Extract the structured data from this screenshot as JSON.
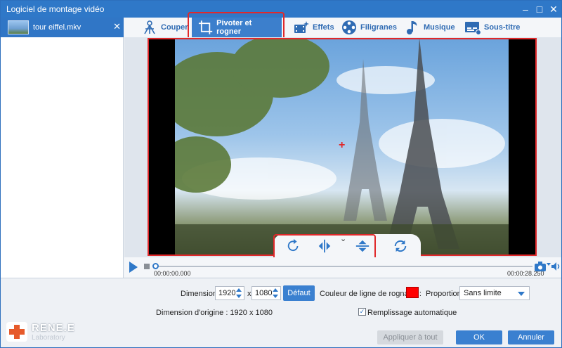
{
  "window": {
    "title": "Logiciel de montage vidéo",
    "min_icon": "–",
    "close_icon": "✕"
  },
  "sidebar": {
    "file_name": "tour eiffel.mkv",
    "close_icon": "✕"
  },
  "tabs": [
    {
      "label": "Couper",
      "icon": "tripod-icon"
    },
    {
      "label": "Pivoter et rogner",
      "icon": "crop-icon",
      "active": true
    },
    {
      "label": "Effets",
      "icon": "effects-film-icon"
    },
    {
      "label": "Filigranes",
      "icon": "watermark-reel-icon"
    },
    {
      "label": "Musique",
      "icon": "music-note-icon"
    },
    {
      "label": "Sous-titre",
      "icon": "subtitle-icon"
    }
  ],
  "preview": {
    "crosshair": "+",
    "toggle_caret": "⌄"
  },
  "timeline": {
    "time_start": "00:00:00.000",
    "time_end": "00:00:28.250",
    "progress": 0.0
  },
  "controls": {
    "dimension_label": "Dimension :",
    "width_value": "1920",
    "x_sep": "x",
    "height_value": "1080",
    "default_button": "Défaut",
    "crop_color_label": "Couleur de ligne de rognage :",
    "crop_color": "#ff0000",
    "ratio_label": "Proportion :",
    "ratio_value": "Sans limite",
    "origin_label": "Dimension d'origine : 1920 x 1080",
    "autofill_label": "Remplissage automatique",
    "autofill_checked": true
  },
  "footer": {
    "apply_all": "Appliquer à tout",
    "ok": "OK",
    "cancel": "Annuler",
    "logo_text": "RENE.E",
    "logo_sub": "Laboratory"
  },
  "colors": {
    "accent": "#2f78c8",
    "highlight": "#e0282a",
    "active_tab": "#3c7fcc"
  }
}
